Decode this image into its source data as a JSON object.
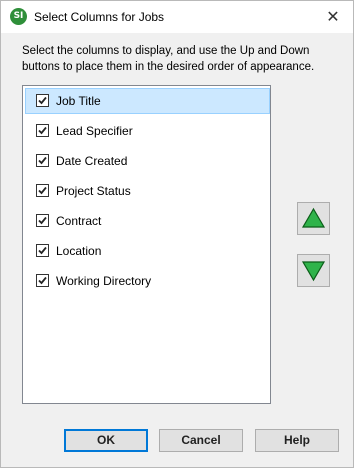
{
  "window": {
    "title": "Select Columns for Jobs",
    "icon_text": "SI",
    "close_glyph": "✕"
  },
  "instructions": "Select the columns to display, and use the Up and Down buttons to place them in the desired order of appearance.",
  "columns": [
    {
      "label": "Job Title",
      "checked": true,
      "selected": true
    },
    {
      "label": "Lead Specifier",
      "checked": true,
      "selected": false
    },
    {
      "label": "Date Created",
      "checked": true,
      "selected": false
    },
    {
      "label": "Project Status",
      "checked": true,
      "selected": false
    },
    {
      "label": "Contract",
      "checked": true,
      "selected": false
    },
    {
      "label": "Location",
      "checked": true,
      "selected": false
    },
    {
      "label": "Working Directory",
      "checked": true,
      "selected": false
    }
  ],
  "buttons": {
    "ok": "OK",
    "cancel": "Cancel",
    "help": "Help"
  },
  "colors": {
    "arrow_fill": "#2fb34a",
    "arrow_stroke": "#0b5d18",
    "selection": "#cce8ff"
  },
  "icons": {
    "move_up": "up-arrow-icon",
    "move_down": "down-arrow-icon"
  }
}
